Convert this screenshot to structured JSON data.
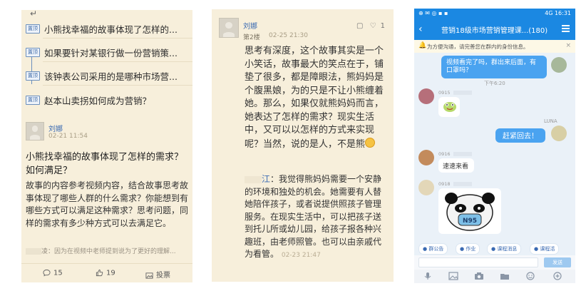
{
  "panel1": {
    "corner_mark": "↵",
    "topics": [
      {
        "tag": "置顶",
        "title": "小熊找幸福的故事体现了怎样的..."
      },
      {
        "tag": "置顶",
        "title": "如果要针对某银行做一份营销策..."
      },
      {
        "tag": "置顶",
        "title": "该钟表公司采用的是哪种市场营..."
      },
      {
        "tag": "置顶",
        "title": "赵本山卖拐如何成为营销？"
      }
    ],
    "post": {
      "user": "刘娜",
      "time": "02-21 11:54",
      "title": "小熊找幸福的故事体现了怎样的需求？如何满足？",
      "body": "故事的内容参考视频内容，结合故事思考故事体现了哪些人群的什么需求？你能想到有哪些方式可以满足这种需求？思考问题，同样的需求有多少种方式可以去满足它。",
      "reply_preview_suffix": "凌：因为在视频中老师提到说为了更好的理解..."
    },
    "footer": {
      "comments": "15",
      "likes": "19",
      "share": "投票"
    }
  },
  "panel2": {
    "user": "刘娜",
    "floor": "第2楼",
    "time": "02-25 21:30",
    "like_count": "1",
    "para1": "思考有深度，这个故事其实是一个小笑话，故事最大的笑点在于，铺垫了很多，都是障眼法，熊妈妈是个腹黑娘，为的只是不让小熊缠着她。那么，如果仅就熊妈妈而言，她表达了怎样的需求？现实生活中，又可以以怎样的方式来实现呢？当然，说的是人，不是熊",
    "quote_name_suffix": "江",
    "quote_body": "：我觉得熊妈妈需要一个安静的环境和独处的机会。她需要有人替她陪伴孩子，或者说提供照孩子管理服务。在现实生活中，可以把孩子送到托儿所或幼儿园，给孩子报各种兴趣班，由老师照管。也可以由亲戚代为看管。",
    "quote_time": "02-23 21:47"
  },
  "panel3": {
    "status_icons": "⊕ ✉ ◎ ▪ ▪",
    "clock": "4G 16:31",
    "back": "‹",
    "title": "营销18级市场营销管理课...(180)",
    "notice": "为方便沟通，请完善您在群内的身份信息。",
    "notice_close": "×",
    "bubble_top": "视频看完了吗，群出来后面，有口罩吗？",
    "time_1": "下午6:20",
    "time_2": "LUNA",
    "bubble_right": "赶紧回去！",
    "bubble_small": "速速来看",
    "mask_label": "N95",
    "chips": [
      "群公告",
      "作业",
      "课程消息",
      "课程活"
    ],
    "send": "发送"
  },
  "colors": {
    "paper": "#f7efdb",
    "accent_blue": "#1b88e2",
    "link_blue": "#3a6ab2"
  }
}
